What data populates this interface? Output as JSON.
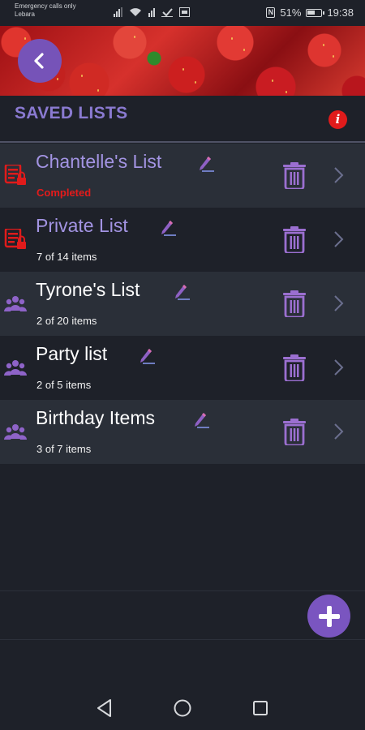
{
  "status_bar": {
    "carrier_line1": "Emergency calls only",
    "carrier_line2": "Lebara",
    "battery": "51%",
    "time": "19:38"
  },
  "header": {
    "title": "SAVED LISTS",
    "info_label": "i"
  },
  "lists": [
    {
      "name": "Chantelle's List",
      "subtitle": "Completed",
      "type": "private",
      "status": "completed"
    },
    {
      "name": "Private List",
      "subtitle": "7 of 14 items",
      "type": "private",
      "status": "in-progress"
    },
    {
      "name": "Tyrone's List",
      "subtitle": "2 of 20 items",
      "type": "shared",
      "status": "in-progress"
    },
    {
      "name": "Party list",
      "subtitle": "2 of 5 items",
      "type": "shared",
      "status": "in-progress"
    },
    {
      "name": "Birthday Items",
      "subtitle": "3 of 7 items",
      "type": "shared",
      "status": "in-progress"
    }
  ],
  "icons": {
    "back": "chevron-left-icon",
    "info": "info-icon",
    "private_list": "locked-list-icon",
    "shared_list": "group-icon",
    "edit": "pencil-icon",
    "delete": "trash-icon",
    "open": "chevron-right-icon",
    "add": "plus-icon",
    "nav_back": "triangle-back-icon",
    "nav_home": "circle-home-icon",
    "nav_recent": "square-recent-icon"
  },
  "colors": {
    "background": "#1e2129",
    "row_alt": "#2a2f38",
    "accent_purple": "#7653b8",
    "title_purple": "#8a7ad1",
    "alert_red": "#e41b1b"
  }
}
